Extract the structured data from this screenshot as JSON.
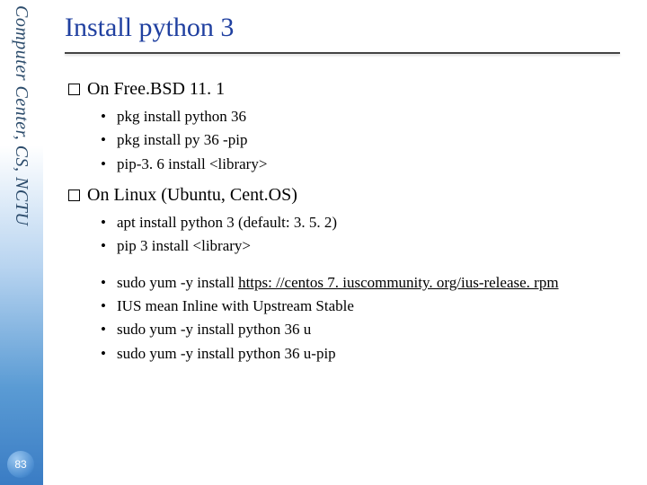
{
  "sidebar": {
    "label": "Computer Center, CS, NCTU"
  },
  "page_number": "83",
  "title": "Install python 3",
  "sections": [
    {
      "heading": "On Free.BSD 11. 1",
      "items": [
        "pkg install python 36",
        "pkg install py 36 -pip",
        "pip-3. 6 install <library>"
      ]
    },
    {
      "heading": "On Linux (Ubuntu, Cent.OS)",
      "items": [
        "apt install python 3 (default: 3. 5. 2)",
        "pip 3 install <library>"
      ],
      "items2": [
        {
          "prefix": "sudo yum -y install ",
          "link": "https: //centos 7. iuscommunity. org/ius-release. rpm",
          "suffix": ""
        },
        {
          "prefix": "IUS mean Inline with Upstream Stable",
          "link": "",
          "suffix": ""
        },
        {
          "prefix": "sudo yum -y install python 36 u",
          "link": "",
          "suffix": ""
        },
        {
          "prefix": "sudo yum -y install python 36 u-pip",
          "link": "",
          "suffix": ""
        }
      ]
    }
  ]
}
